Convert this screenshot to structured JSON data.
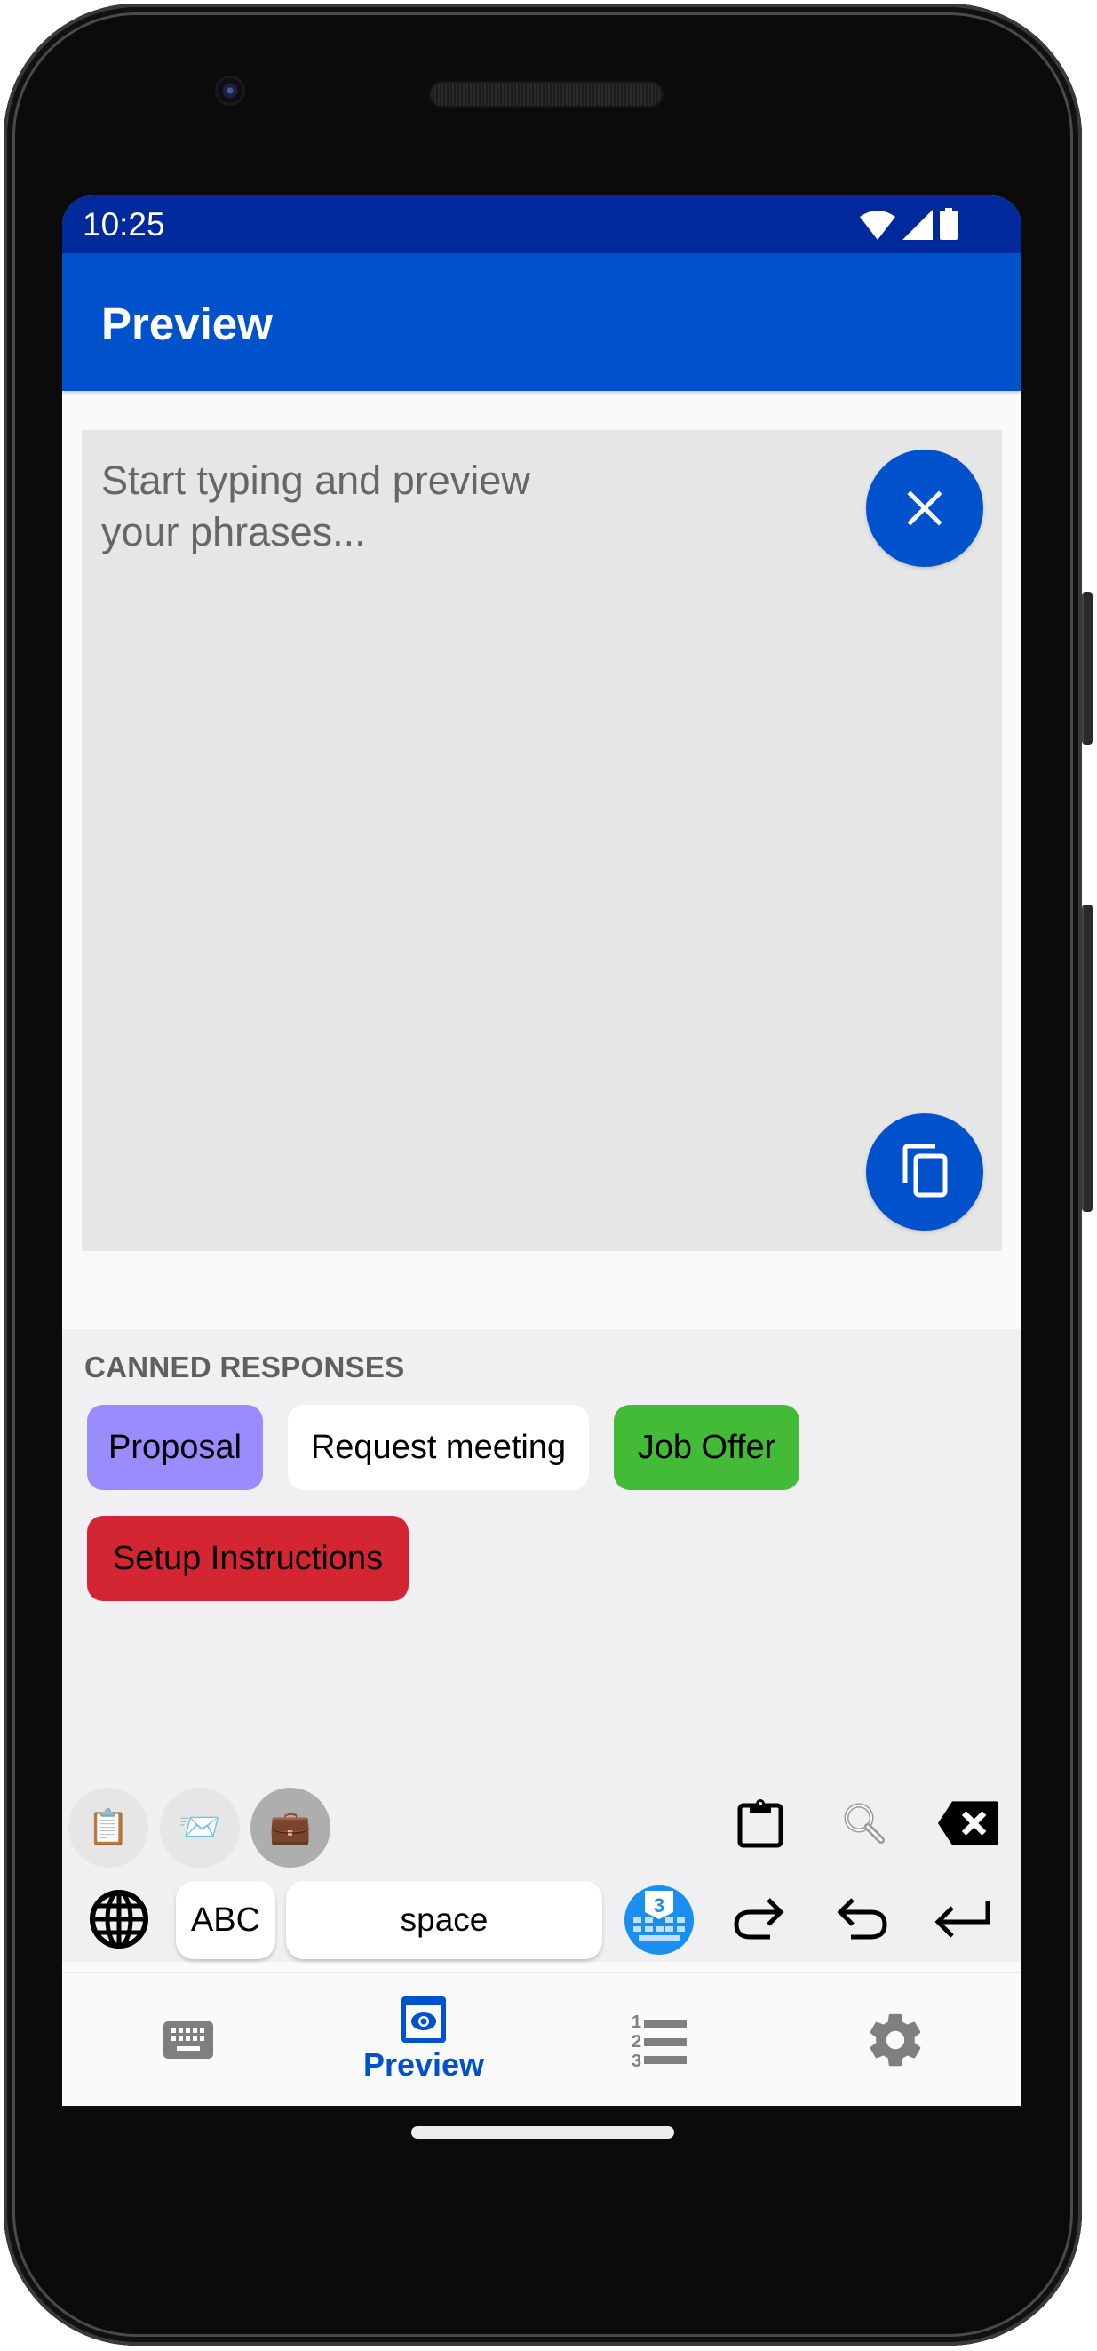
{
  "status_bar": {
    "time": "10:25",
    "icons": [
      "wifi-icon",
      "signal-icon",
      "battery-icon"
    ]
  },
  "app_bar": {
    "title": "Preview"
  },
  "preview": {
    "placeholder": "Start typing and preview your phrases...",
    "value": "",
    "clear_button": "close-icon",
    "copy_button": "copy-icon"
  },
  "canned_responses": {
    "heading": "CANNED RESPONSES",
    "items": [
      {
        "label": "Proposal",
        "color": "#9a8cff"
      },
      {
        "label": "Request meeting",
        "color": "#ffffff"
      },
      {
        "label": "Job Offer",
        "color": "#44bb37"
      },
      {
        "label": "Setup Instructions",
        "color": "#d42632"
      }
    ]
  },
  "keyboard": {
    "categories": [
      {
        "icon": "clipboard-emoji-icon",
        "glyph": "📋",
        "active": false
      },
      {
        "icon": "envelope-emoji-icon",
        "glyph": "📨",
        "active": false
      },
      {
        "icon": "briefcase-emoji-icon",
        "glyph": "💼",
        "active": true
      }
    ],
    "toolbar_icons": [
      "clipboard-icon",
      "search-icon",
      "backspace-icon"
    ],
    "abc_label": "ABC",
    "space_label": "space",
    "bottom_icons": [
      "globe-icon",
      "app-logo-icon",
      "redo-icon",
      "undo-icon",
      "enter-icon"
    ]
  },
  "bottom_nav": {
    "items": [
      {
        "icon": "keyboard-icon",
        "label": "",
        "active": false
      },
      {
        "icon": "preview-icon",
        "label": "Preview",
        "active": true
      },
      {
        "icon": "numbered-list-icon",
        "label": "",
        "active": false
      },
      {
        "icon": "settings-icon",
        "label": "",
        "active": false
      }
    ]
  },
  "colors": {
    "primary": "#0052cc",
    "status_bar": "#00299c",
    "inactive_icon": "#7f7f7f"
  }
}
